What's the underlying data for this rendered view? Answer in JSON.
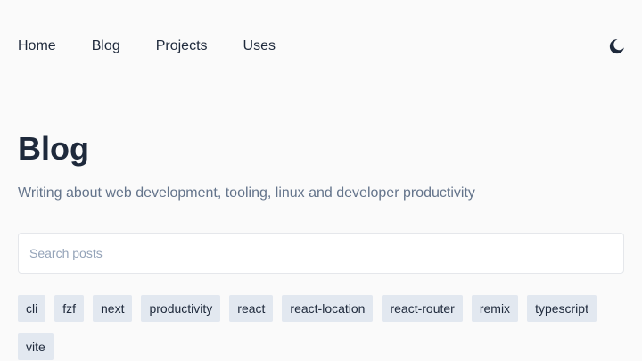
{
  "nav": {
    "items": [
      {
        "label": "Home"
      },
      {
        "label": "Blog"
      },
      {
        "label": "Projects"
      },
      {
        "label": "Uses"
      }
    ],
    "theme_icon": "moon-icon"
  },
  "page": {
    "title": "Blog",
    "subtitle": "Writing about web development, tooling, linux and developer productivity"
  },
  "search": {
    "placeholder": "Search posts",
    "value": ""
  },
  "tags": [
    {
      "label": "cli"
    },
    {
      "label": "fzf"
    },
    {
      "label": "next"
    },
    {
      "label": "productivity"
    },
    {
      "label": "react"
    },
    {
      "label": "react-location"
    },
    {
      "label": "react-router"
    },
    {
      "label": "remix"
    },
    {
      "label": "typescript"
    },
    {
      "label": "vite"
    }
  ],
  "colors": {
    "background": "#fafafa",
    "text": "#1e293b",
    "muted": "#64748b",
    "tag_bg": "#e2e8f0"
  }
}
